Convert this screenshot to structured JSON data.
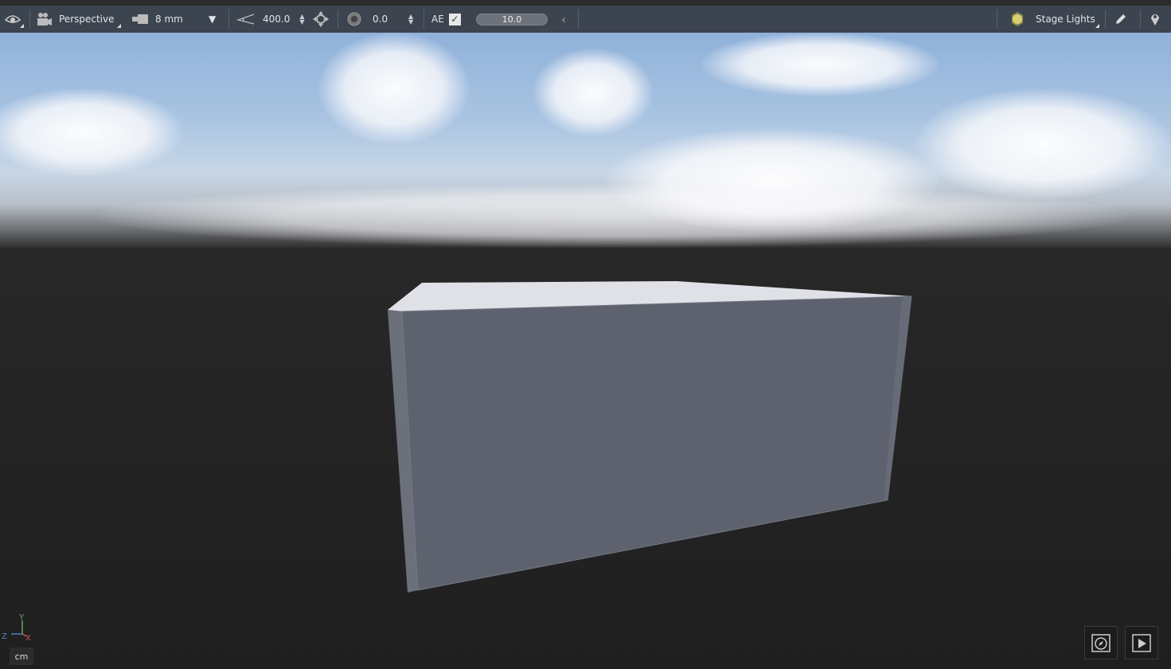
{
  "toolbar": {
    "view_mode_icon": "eye-icon",
    "camera_icon": "movie-camera-icon",
    "camera_label": "Perspective",
    "lens_icon": "lens-icon",
    "lens_label": "8 mm",
    "fov_icon": "angle-icon",
    "fov_value": "400.0",
    "target_icon": "crosshair-icon",
    "aperture_icon": "aperture-icon",
    "aperture_value": "0.0",
    "ae_label": "AE",
    "ae_checked": true,
    "exposure_value": "10.0",
    "lights_icon": "sun-icon",
    "lights_label": "Stage Lights",
    "edit_icon": "pencil-icon",
    "pin_icon": "map-pin-icon"
  },
  "viewport": {
    "axis": {
      "y": "Y",
      "z": "Z",
      "x": "X"
    },
    "unit": "cm",
    "colors": {
      "y": "#5fa86a",
      "z": "#4a86c0",
      "x": "#c05a5a",
      "box_front": "#5d626e",
      "box_top": "#e2e4ea"
    }
  }
}
